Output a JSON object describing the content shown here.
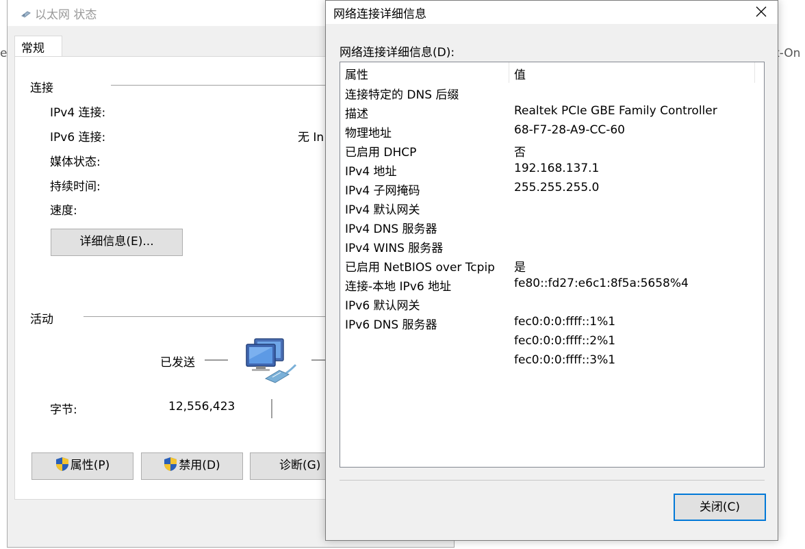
{
  "background_text": {
    "left": "e",
    "right": "t-On"
  },
  "status_window": {
    "title": "以太网 状态",
    "tab": "常规",
    "connection": {
      "section": "连接",
      "ipv4_label": "IPv4 连接:",
      "ipv6_label": "IPv6 连接:",
      "ipv6_value": "无 In",
      "media_label": "媒体状态:",
      "duration_label": "持续时间:",
      "speed_label": "速度:",
      "details_button": "详细信息(E)..."
    },
    "activity": {
      "section": "活动",
      "sent_label": "已发送",
      "bytes_label": "字节:",
      "bytes_sent": "12,556,423"
    },
    "buttons": {
      "properties": "属性(P)",
      "disable": "禁用(D)",
      "diagnose": "诊断(G)"
    }
  },
  "details_dialog": {
    "title": "网络连接详细信息",
    "list_label": "网络连接详细信息(D):",
    "columns": {
      "property": "属性",
      "value": "值"
    },
    "rows": [
      {
        "property": "连接特定的 DNS 后缀",
        "value": ""
      },
      {
        "property": "描述",
        "value": "Realtek PCIe GBE Family Controller"
      },
      {
        "property": "物理地址",
        "value": "68-F7-28-A9-CC-60"
      },
      {
        "property": "已启用 DHCP",
        "value": "否"
      },
      {
        "property": "IPv4 地址",
        "value": "192.168.137.1"
      },
      {
        "property": "IPv4 子网掩码",
        "value": "255.255.255.0"
      },
      {
        "property": "IPv4 默认网关",
        "value": ""
      },
      {
        "property": "IPv4 DNS 服务器",
        "value": ""
      },
      {
        "property": "IPv4 WINS 服务器",
        "value": ""
      },
      {
        "property": "已启用 NetBIOS over Tcpip",
        "value": "是"
      },
      {
        "property": "连接-本地 IPv6 地址",
        "value": "fe80::fd27:e6c1:8f5a:5658%4"
      },
      {
        "property": "IPv6 默认网关",
        "value": ""
      },
      {
        "property": "IPv6 DNS 服务器",
        "value": "fec0:0:0:ffff::1%1"
      },
      {
        "property": "",
        "value": "fec0:0:0:ffff::2%1"
      },
      {
        "property": "",
        "value": "fec0:0:0:ffff::3%1"
      }
    ],
    "close_button": "关闭(C)"
  }
}
